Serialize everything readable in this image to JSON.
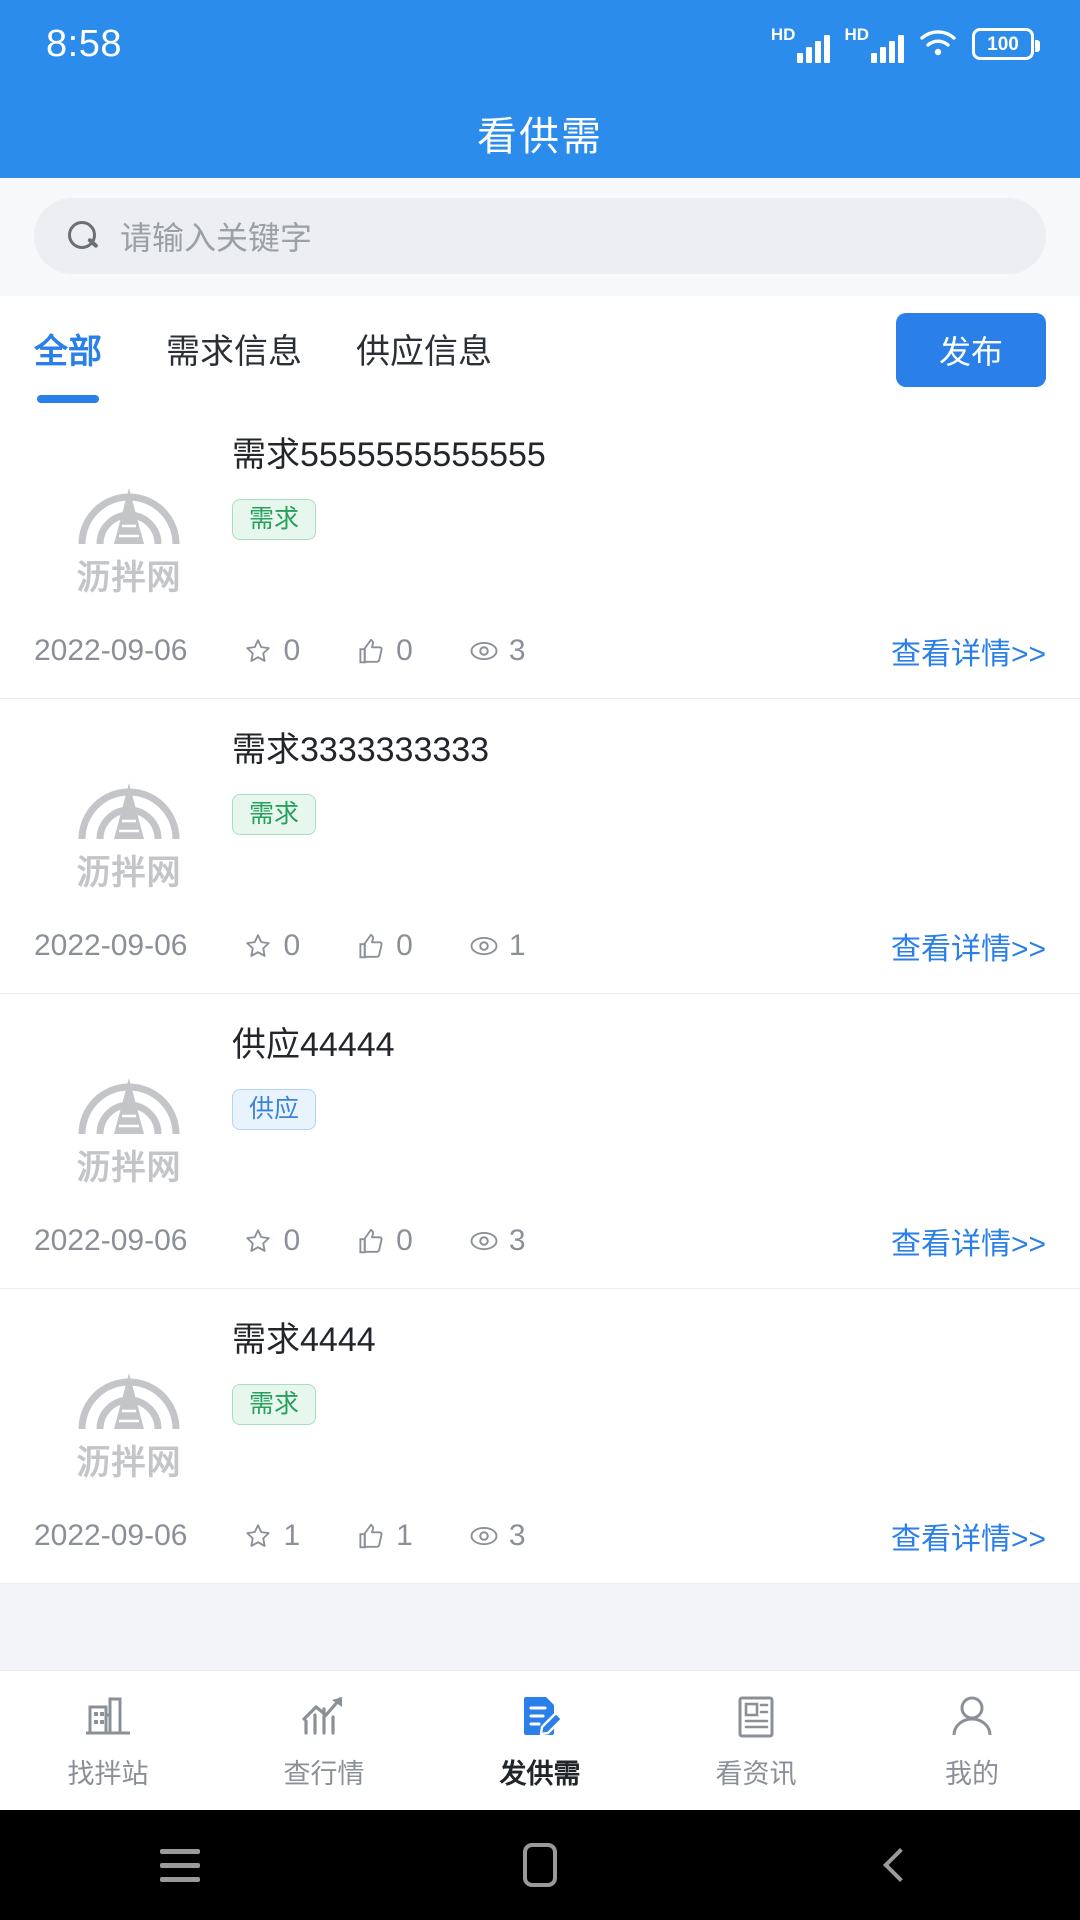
{
  "status_bar": {
    "time": "8:58",
    "hd_label_1": "HD",
    "hd_label_2": "HD",
    "battery": "100"
  },
  "header": {
    "title": "看供需"
  },
  "search": {
    "placeholder": "请输入关键字",
    "icon": "search-icon"
  },
  "tabs": {
    "items": [
      {
        "label": "全部",
        "active": true
      },
      {
        "label": "需求信息",
        "active": false
      },
      {
        "label": "供应信息",
        "active": false
      }
    ],
    "publish_button": "发布"
  },
  "list": {
    "logo_text": "沥拌网",
    "detail_link": "查看详情>>",
    "items": [
      {
        "title": "需求5555555555555",
        "badge": "需求",
        "badge_type": "need",
        "date": "2022-09-06",
        "favorites": "0",
        "likes": "0",
        "views": "3"
      },
      {
        "title": "需求3333333333",
        "badge": "需求",
        "badge_type": "need",
        "date": "2022-09-06",
        "favorites": "0",
        "likes": "0",
        "views": "1"
      },
      {
        "title": "供应44444",
        "badge": "供应",
        "badge_type": "supply",
        "date": "2022-09-06",
        "favorites": "0",
        "likes": "0",
        "views": "3"
      },
      {
        "title": "需求4444",
        "badge": "需求",
        "badge_type": "need",
        "date": "2022-09-06",
        "favorites": "1",
        "likes": "1",
        "views": "3"
      }
    ]
  },
  "bottom_nav": {
    "items": [
      {
        "label": "找拌站",
        "icon": "plant-icon",
        "active": false
      },
      {
        "label": "查行情",
        "icon": "chart-trend-icon",
        "active": false
      },
      {
        "label": "发供需",
        "icon": "document-edit-icon",
        "active": true
      },
      {
        "label": "看资讯",
        "icon": "news-icon",
        "active": false
      },
      {
        "label": "我的",
        "icon": "person-icon",
        "active": false
      }
    ]
  },
  "system_nav": {
    "recents": "recents-icon",
    "home": "home-icon",
    "back": "back-icon"
  },
  "colors": {
    "brand_blue": "#2b8ceb",
    "accent_blue": "#2b7fe8",
    "need_green": "#27a05e",
    "supply_blue": "#3b83d6"
  }
}
